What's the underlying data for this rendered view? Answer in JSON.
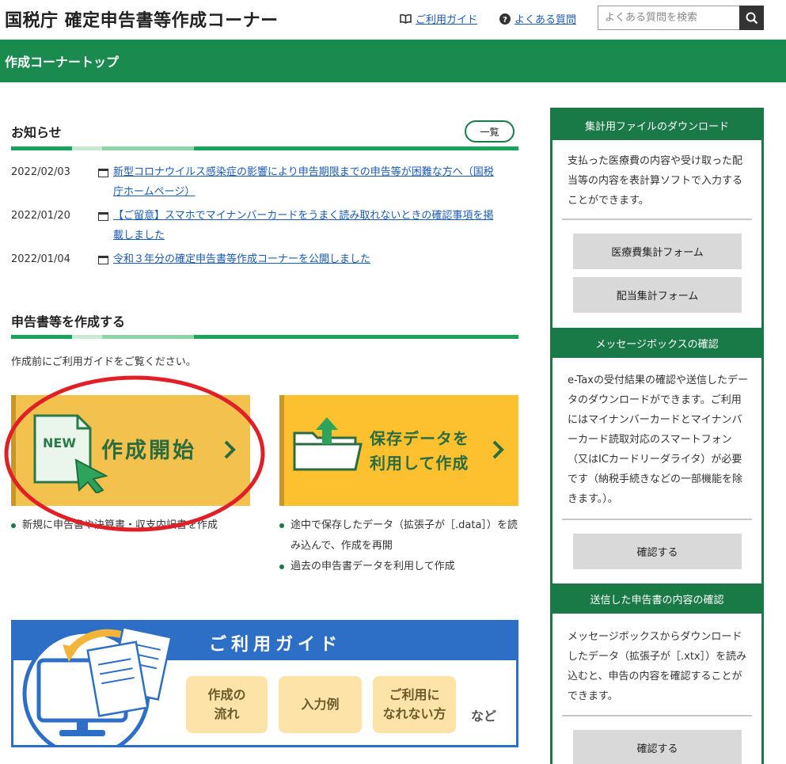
{
  "header": {
    "site_title": "国税庁 確定申告書等作成コーナー",
    "guide_link": "ご利用ガイド",
    "faq_link": "よくある質問",
    "search_placeholder": "よくある質問を検索"
  },
  "nav_bar": {
    "label": "作成コーナートップ"
  },
  "notices": {
    "title": "お知らせ",
    "more_button": "一覧",
    "items": [
      {
        "date": "2022/02/03",
        "text": "新型コロナウイルス感染症の影響により申告期限までの申告等が困難な方へ（国税庁ホームページ）"
      },
      {
        "date": "2022/01/20",
        "text": "【ご留意】スマホでマイナンバーカードをうまく読み取れないときの確認事項を掲載しました"
      },
      {
        "date": "2022/01/04",
        "text": "令和３年分の確定申告書等作成コーナーを公開しました"
      }
    ]
  },
  "create": {
    "title": "申告書等を作成する",
    "intro": "作成前にご利用ガイドをご覧ください。",
    "start_card": {
      "badge": "NEW",
      "title": "作成開始",
      "bullets": [
        "新規に申告書や決算書・収支内訳書を作成"
      ]
    },
    "saved_card": {
      "title_line1": "保存データを",
      "title_line2": "利用して作成",
      "bullets": [
        "途中で保存したデータ（拡張子が［.data］）を読み込んで、作成を再開",
        "過去の申告書データを利用して作成"
      ]
    }
  },
  "guide_banner": {
    "title": "ご利用ガイド",
    "pill1_line1": "作成の",
    "pill1_line2": "流れ",
    "pill2": "入力例",
    "pill3_line1": "ご利用に",
    "pill3_line2": "なれない方",
    "etc": "など"
  },
  "sidebar": {
    "download": {
      "title": "集計用ファイルのダウンロード",
      "text": "支払った医療費の内容や受け取った配当等の内容を表計算ソフトで入力することができます。",
      "button1": "医療費集計フォーム",
      "button2": "配当集計フォーム"
    },
    "messagebox": {
      "title": "メッセージボックスの確認",
      "text": "e-Taxの受付結果の確認や送信したデータのダウンロードができます。ご利用にはマイナンバーカードとマイナンバーカード読取対応のスマートフォン（又はICカードリーダライタ）が必要です（納税手続きなどの一部機能を除きます。）。",
      "button": "確認する"
    },
    "sent": {
      "title": "送信した申告書の内容の確認",
      "text": "メッセージボックスからダウンロードしたデータ（拡張子が［.xtx］）を読み込むと、申告の内容を確認することができます。",
      "button": "確認する"
    }
  },
  "colors": {
    "brand_green": "#1a8a4f",
    "card_yellow": "#f7c543",
    "link_blue": "#1a5bb5",
    "guide_blue": "#2d6fc6",
    "highlight_red": "#e01f26"
  }
}
